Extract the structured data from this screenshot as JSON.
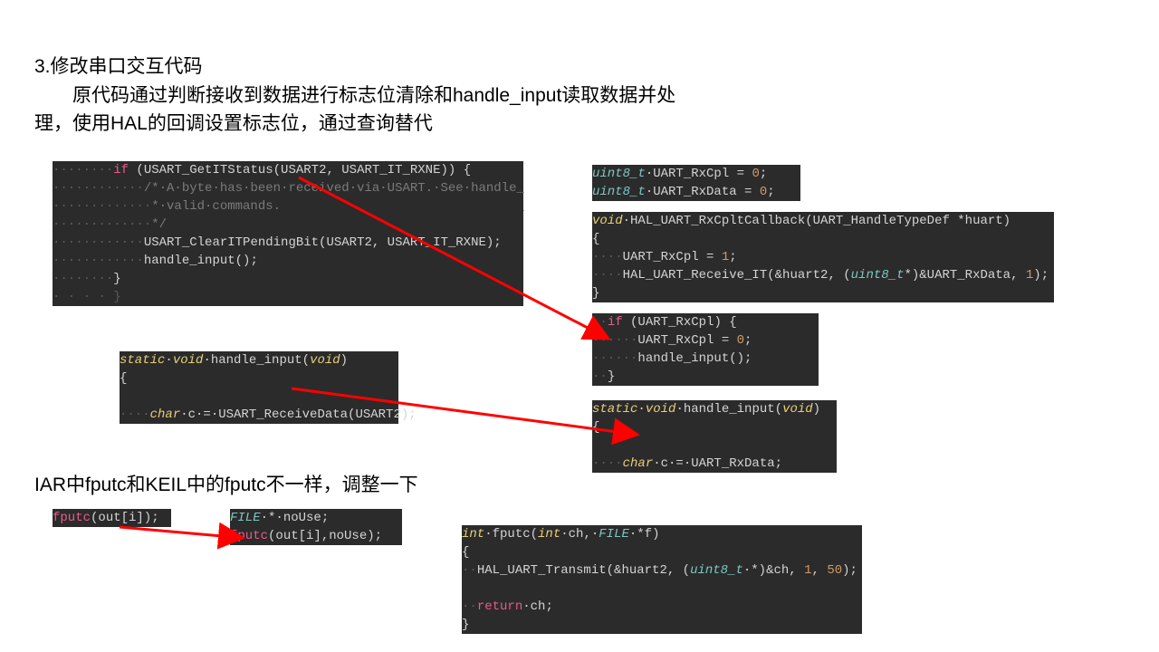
{
  "heading1_line1": "3.修改串口交互代码",
  "heading1_line2": "　　原代码通过判断接收到数据进行标志位清除和handle_input读取数据并处",
  "heading1_line3": "理，使用HAL的回调设置标志位，通过查询替代",
  "heading2": "IAR中fputc和KEIL中的fputc不一样，调整一下",
  "code1": {
    "l1_a": "· · · · if",
    "l1_b": " (USART_GetITStatus(USART2, USART_IT_RXNE)) {",
    "l2": "· · · · · · /* A byte has been received via USART. See handle_",
    "l3": "· · · · · · * valid commands.",
    "l4": "· · · · · · */",
    "l5": "· · · · · · USART_ClearITPendingBit(USART2, USART_IT_RXNE);",
    "l6": "· · · · · · handle_input();",
    "l7": "· · · · }"
  },
  "code2": {
    "l1_a": "static",
    "l1_b": " void",
    "l1_c": " handle_input(",
    "l1_d": "void",
    "l1_e": ")",
    "l2": "{",
    "l3": "",
    "l4_a": "· · char",
    "l4_b": " c = USART_ReceiveData(USART2);"
  },
  "code3": {
    "l1_a": "uint8_t",
    "l1_b": " UART_RxCpl = ",
    "l1_c": "0",
    "l1_d": ";",
    "l2_a": "uint8_t",
    "l2_b": " UART_RxData = ",
    "l2_c": "0",
    "l2_d": ";"
  },
  "code4": {
    "l1_a": "void",
    "l1_b": " HAL_UART_RxCpltCallback(UART_HandleTypeDef *huart)",
    "l2": "{",
    "l3_a": "· · UART_RxCpl = ",
    "l3_b": "1",
    "l3_c": ";",
    "l4_a": "· · HAL_UART_Receive_IT(&huart2, (",
    "l4_b": "uint8_t",
    "l4_c": "*)&UART_RxData, ",
    "l4_d": "1",
    "l4_e": ");",
    "l5": "}"
  },
  "code5": {
    "l1_a": "· if",
    "l1_b": " (UART_RxCpl) {",
    "l2_a": "· · · UART_RxCpl = ",
    "l2_b": "0",
    "l2_c": ";",
    "l3": "· · · handle_input();",
    "l4": "· }"
  },
  "code6": {
    "l1_a": "static",
    "l1_b": " void",
    "l1_c": " handle_input(",
    "l1_d": "void",
    "l1_e": ")",
    "l2": "{",
    "l3": "",
    "l4_a": "· · char",
    "l4_b": " c = UART_RxData;"
  },
  "code7": {
    "l1_a": "fputc",
    "l1_b": "(out[i]);"
  },
  "code8": {
    "l1_a": "FILE",
    "l1_b": " * noUse;",
    "l2_a": "fputc",
    "l2_b": "(out[i],noUse);"
  },
  "code9": {
    "l1_a": "int",
    "l1_b": " fputc(",
    "l1_c": "int",
    "l1_d": " ch, ",
    "l1_e": "FILE",
    "l1_f": " *f)",
    "l2": "{",
    "l3_a": "· HAL_UART_Transmit(&huart2, (",
    "l3_b": "uint8_t",
    "l3_c": " *)&ch, ",
    "l3_d": "1",
    "l3_e": ", ",
    "l3_f": "50",
    "l3_g": ");",
    "l4": "",
    "l5_a": "· return",
    "l5_b": " ch;",
    "l6": "}"
  }
}
